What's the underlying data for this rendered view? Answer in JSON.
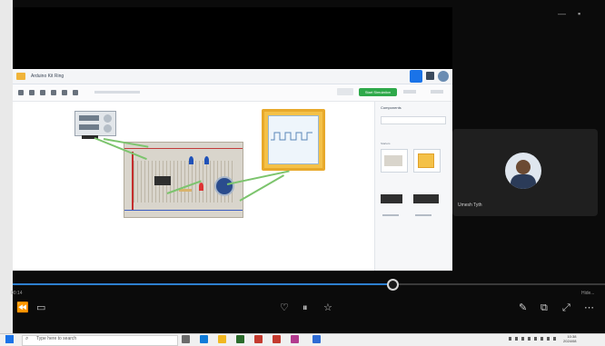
{
  "player": {
    "elapsed_time": "00:14",
    "remaining_time": "Hide...",
    "progress": 0.64,
    "controls": {
      "back_label": "⏪",
      "captions_label": "▭",
      "thumbs_down_label": "♡",
      "pause_label": "⏸",
      "thumbs_up_label": "☆",
      "edit_label": "✎",
      "screen_label": "⧉",
      "fullscreen_label": "⤢",
      "more_label": "⋯"
    }
  },
  "shared_screen": {
    "app_title": "Arduino Kit Ring",
    "toolbar_label": "Start Simulation",
    "panel_title": "Components",
    "panel_search_placeholder": "Search",
    "panel_section_label": "Starters",
    "panel_items": [
      "Oscilloscope",
      "Breadboard",
      "Arduino",
      "555 Timer"
    ]
  },
  "participant": {
    "name": "Umesh Tyth"
  },
  "taskbar": {
    "search_placeholder": "Type here to search",
    "clock_time": "10:38",
    "clock_date": "2024/08"
  },
  "colors": {
    "accent": "#2d7fcf",
    "scope": "#f4c148",
    "sim_green": "#2ea94a"
  }
}
